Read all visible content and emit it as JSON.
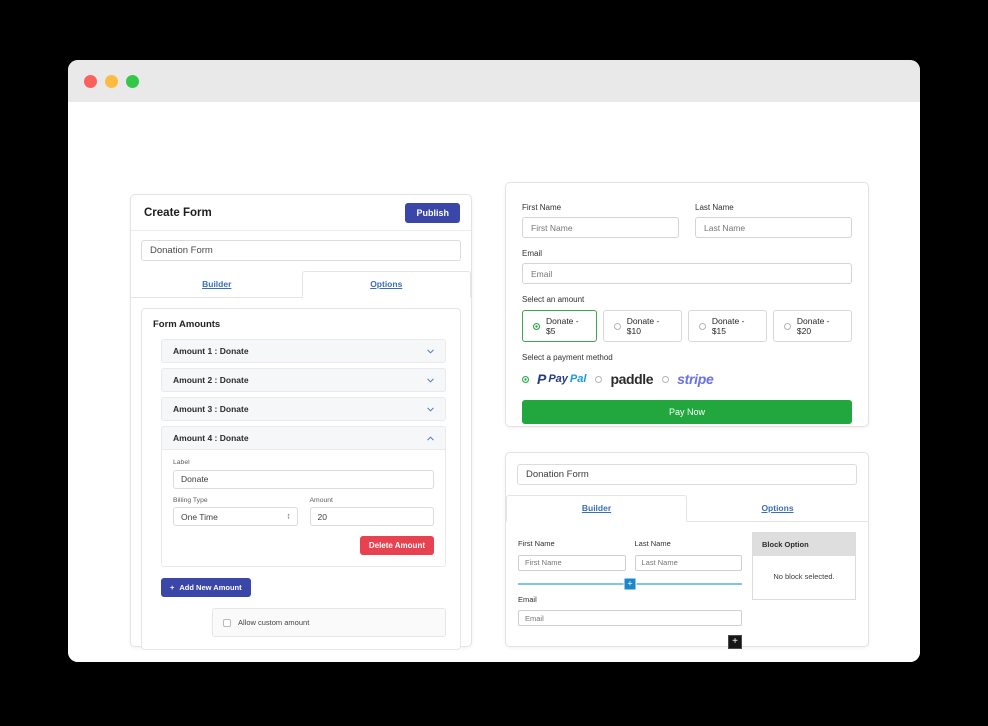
{
  "window": {
    "traffic_lights": [
      "close",
      "minimize",
      "maximize"
    ]
  },
  "left_panel": {
    "header_title": "Create Form",
    "publish_label": "Publish",
    "form_title_value": "Donation Form",
    "tabs": [
      {
        "label": "Builder",
        "active": false
      },
      {
        "label": "Options",
        "active": true
      }
    ],
    "section_heading": "Form Amounts",
    "accordions": [
      {
        "label": "Amount 1 : Donate",
        "expanded": false
      },
      {
        "label": "Amount 2 : Donate",
        "expanded": false
      },
      {
        "label": "Amount 3 : Donate",
        "expanded": false
      },
      {
        "label": "Amount 4 : Donate",
        "expanded": true
      }
    ],
    "expanded_form": {
      "label_label": "Label",
      "label_value": "Donate",
      "billing_type_label": "Billing Type",
      "billing_type_value": "One Time",
      "billing_type_options": [
        "One Time"
      ],
      "amount_label": "Amount",
      "amount_value": "20",
      "delete_label": "Delete Amount"
    },
    "add_new_amount_label": "Add New Amount",
    "add_new_amount_icon": "plus-icon",
    "allow_custom_amount_label": "Allow custom amount",
    "allow_custom_amount_checked": false
  },
  "preview_panel": {
    "first_name_label": "First Name",
    "first_name_placeholder": "First Name",
    "last_name_label": "Last Name",
    "last_name_placeholder": "Last Name",
    "email_label": "Email",
    "email_placeholder": "Email",
    "amount_section_label": "Select an amount",
    "amount_options": [
      {
        "label": "Donate - $5",
        "selected": true
      },
      {
        "label": "Donate - $10",
        "selected": false
      },
      {
        "label": "Donate - $15",
        "selected": false
      },
      {
        "label": "Donate - $20",
        "selected": false
      }
    ],
    "payment_section_label": "Select a payment method",
    "payment_methods": [
      {
        "name": "paypal",
        "text": "PayPal",
        "selected": true
      },
      {
        "name": "paddle",
        "text": "paddle",
        "selected": false
      },
      {
        "name": "stripe",
        "text": "stripe",
        "selected": false
      }
    ],
    "pay_now_label": "Pay Now",
    "colors": {
      "selected_green": "#2aa745",
      "pay_button_green": "#22a73f",
      "paypal_dark": "#253b80",
      "paypal_light": "#179bd7",
      "stripe_purple": "#6772e5"
    }
  },
  "builder_panel": {
    "title_value": "Donation Form",
    "tabs": [
      {
        "label": "Builder",
        "active": true
      },
      {
        "label": "Options",
        "active": false
      }
    ],
    "fields": {
      "first_name_label": "First Name",
      "first_name_placeholder": "First Name",
      "last_name_label": "Last Name",
      "last_name_placeholder": "Last Name",
      "email_label": "Email",
      "email_placeholder": "Email"
    },
    "insert_plus_icon": "plus-icon",
    "add_block_icon": "plus-icon",
    "block_option": {
      "header": "Block Option",
      "empty_text": "No block selected."
    }
  }
}
